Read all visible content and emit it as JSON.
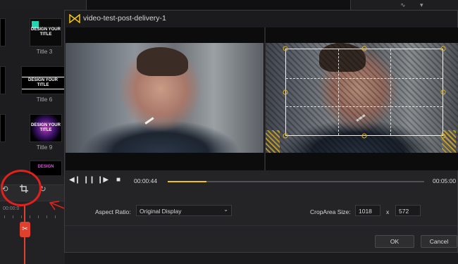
{
  "dialog": {
    "title": "video-test-post-delivery-1",
    "playback": {
      "current_time": "00:00:44",
      "end_time": "00:05:00",
      "progress_fraction": 0.15
    },
    "aspect_ratio_label": "Aspect Ratio:",
    "aspect_ratio_value": "Original Display",
    "crop_area_label": "CropArea Size:",
    "crop_width": "1018",
    "crop_separator": "x",
    "crop_height": "572",
    "ok_label": "OK",
    "cancel_label": "Cancel"
  },
  "sidebar": {
    "templates": [
      {
        "label": "Title 3",
        "text": "DESIGN YOUR TITLE"
      },
      {
        "label": "Title 6",
        "text": "DESIGN YOUR TITLE"
      },
      {
        "label": "Title 9",
        "text": "DESIGN YOUR TITLE"
      }
    ],
    "bottom_thumb_text": "DESIGN"
  },
  "timeline": {
    "ruler_text": "00:00:0"
  },
  "annotation": {
    "label": "CROP",
    "color": "#e3201b"
  },
  "colors": {
    "accent": "#f2c312",
    "crop_handle": "#e1ae1a"
  }
}
